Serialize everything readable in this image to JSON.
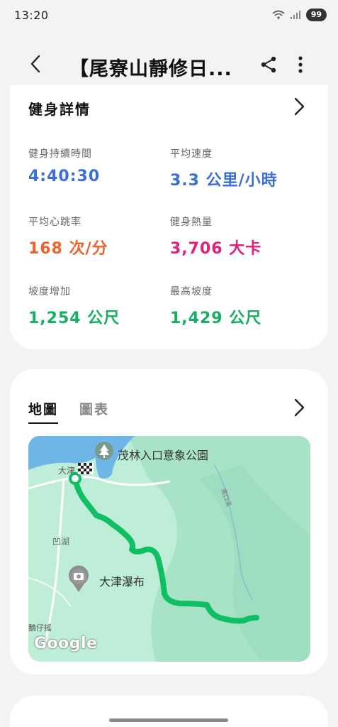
{
  "status_bar": {
    "time": "13:20",
    "battery": "99"
  },
  "app_bar": {
    "title": "【尾寮山靜修日..."
  },
  "fitness": {
    "section_title": "健身詳情",
    "metrics": [
      {
        "label": "健身持續時間",
        "value": "4:40:30",
        "color": "#3a6fd8"
      },
      {
        "label": "平均速度",
        "value": "3.3 公里/小時",
        "color": "#3a6fd8"
      },
      {
        "label": "平均心跳率",
        "value": "168 次/分",
        "color": "#f0622d"
      },
      {
        "label": "健身熱量",
        "value": "3,706 大卡",
        "color": "#e0207a"
      },
      {
        "label": "坡度增加",
        "value": "1,254 公尺",
        "color": "#17b062"
      },
      {
        "label": "最高坡度",
        "value": "1,429 公尺",
        "color": "#17b062"
      }
    ]
  },
  "map_card": {
    "tabs": [
      {
        "label": "地圖",
        "active": true
      },
      {
        "label": "圖表",
        "active": false
      }
    ],
    "labels": {
      "park": "茂林入口意象公園",
      "waterfall": "大津瀑布",
      "ao_hu": "凹湖",
      "da": "大津",
      "stream": "濁口溪",
      "village": "鵝仔搖"
    },
    "google": "Google",
    "route_color": "#0fbf63",
    "water_color": "#6fb6e8",
    "land_color": "#bfeed8"
  }
}
